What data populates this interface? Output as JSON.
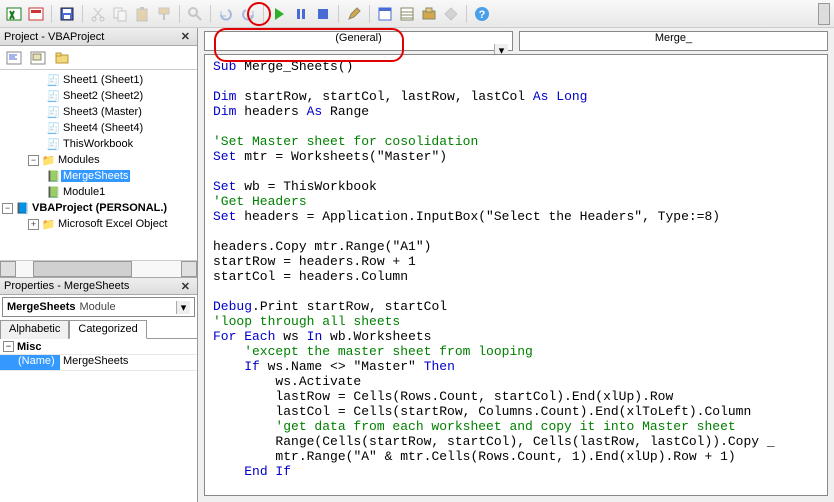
{
  "toolbar": {
    "icons": [
      "excel",
      "access",
      "save",
      "cut",
      "copy",
      "paste",
      "paste",
      "find",
      "undo",
      "redo",
      "run",
      "pause",
      "stop",
      "design",
      "toolbox",
      "project",
      "properties",
      "object",
      "vbe",
      "help"
    ]
  },
  "project_panel": {
    "title": "Project - VBAProject",
    "tree": {
      "sheet1": "Sheet1 (Sheet1)",
      "sheet2": "Sheet2 (Sheet2)",
      "sheet3": "Sheet3 (Master)",
      "sheet4": "Sheet4 (Sheet4)",
      "thiswb": "ThisWorkbook",
      "modules": "Modules",
      "mergesheets": "MergeSheets",
      "module1": "Module1",
      "personal": "VBAProject (PERSONAL.)",
      "msexcel": "Microsoft Excel Object"
    }
  },
  "properties_panel": {
    "title": "Properties - MergeSheets",
    "object_name": "MergeSheets",
    "object_type": "Module",
    "tabs": {
      "alphabetic": "Alphabetic",
      "categorized": "Categorized"
    },
    "rows": {
      "misc": "Misc",
      "name_key": "(Name)",
      "name_val": "MergeSheets"
    }
  },
  "code_panel": {
    "combo_left": "(General)",
    "combo_right": "Merge_"
  },
  "code": {
    "l1a": "Sub",
    "l1b": " Merge_Sheets()",
    "l2": "",
    "l3a": "Dim",
    "l3b": " startRow, startCol, lastRow, lastCol ",
    "l3c": "As Long",
    "l4a": "Dim",
    "l4b": " headers ",
    "l4c": "As",
    "l4d": " Range",
    "l5": "",
    "l6": "'Set Master sheet for cosolidation",
    "l7a": "Set",
    "l7b": " mtr = Worksheets(",
    "l7c": "\"Master\"",
    "l7d": ")",
    "l8": "",
    "l9a": "Set",
    "l9b": " wb = ThisWorkbook",
    "l10": "'Get Headers",
    "l11a": "Set",
    "l11b": " headers = Application.InputBox(",
    "l11c": "\"Select the Headers\"",
    "l11d": ", Type:=8)",
    "l12": "",
    "l13": "headers.Copy mtr.Range(",
    "l13b": "\"A1\"",
    "l13c": ")",
    "l14": "startRow = headers.Row + 1",
    "l15": "startCol = headers.Column",
    "l16": "",
    "l17a": "Debug",
    "l17b": ".Print startRow, startCol",
    "l18": "'loop through all sheets",
    "l19a": "For Each",
    "l19b": " ws ",
    "l19c": "In",
    "l19d": " wb.Worksheets",
    "l20": "    'except the master sheet from looping",
    "l21a": "    ",
    "l21b": "If",
    "l21c": " ws.Name <> ",
    "l21d": "\"Master\"",
    "l21e": " ",
    "l21f": "Then",
    "l22": "        ws.Activate",
    "l23": "        lastRow = Cells(Rows.Count, startCol).End(xlUp).Row",
    "l24": "        lastCol = Cells(startRow, Columns.Count).End(xlToLeft).Column",
    "l25": "        'get data from each worksheet and copy it into Master sheet",
    "l26": "        Range(Cells(startRow, startCol), Cells(lastRow, lastCol)).Copy _",
    "l27a": "        mtr.Range(",
    "l27b": "\"A\"",
    "l27c": " & mtr.Cells(Rows.Count, 1).End(xlUp).Row + 1)",
    "l28a": "    ",
    "l28b": "End If"
  }
}
